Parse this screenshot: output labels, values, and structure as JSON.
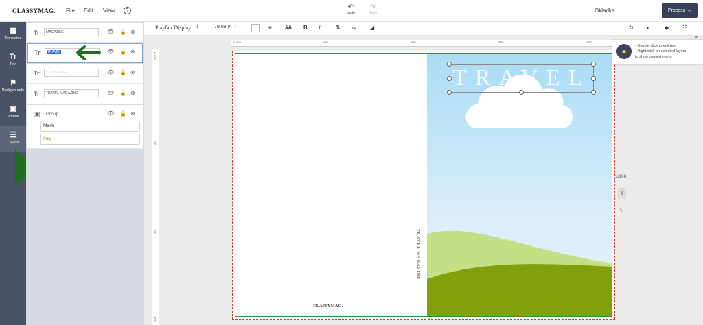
{
  "topbar": {
    "logo": "CLASSYMAG.",
    "menu": [
      "File",
      "Edit",
      "View"
    ],
    "help_glyph": "?",
    "undo_label": "Undo",
    "redo_label": "Redo",
    "doc_title": "Okladka",
    "process_label": "Process →"
  },
  "sidebar": {
    "items": [
      {
        "label": "Templates",
        "icon": "templates-icon"
      },
      {
        "label": "Text",
        "icon": "text-icon"
      },
      {
        "label": "Backgrounds",
        "icon": "backgrounds-icon"
      },
      {
        "label": "Photos",
        "icon": "photos-icon"
      },
      {
        "label": "Layers",
        "icon": "layers-icon"
      }
    ]
  },
  "layers": {
    "items": [
      {
        "type": "Tr",
        "value": "MAGAZINE"
      },
      {
        "type": "Tr",
        "value": "TRAVEL"
      },
      {
        "type": "Tr",
        "value": "CLASSYMAG."
      },
      {
        "type": "Tr",
        "value": "TRAVEL MAGAZINE"
      }
    ],
    "group": {
      "label": "Group",
      "children": [
        "Mask",
        "Img"
      ]
    }
  },
  "toolbar": {
    "font_family": "Playfair Display",
    "font_size": "79.03",
    "unit": "pt",
    "items": [
      "align-icon",
      "letter-spacing-icon",
      "bold-icon",
      "italic-icon",
      "line-height-icon",
      "link-icon",
      "fill-icon"
    ]
  },
  "ruler": {
    "h_labels": [
      "0 mm",
      "100",
      "200",
      "300",
      "400"
    ],
    "v_labels": [
      "0 mm",
      "100",
      "200",
      "300"
    ]
  },
  "canvas": {
    "cover_title": "TRAVEL",
    "spine_text": "TRAVEL MAGAZINE",
    "back_logo": "CLASSYMAG.",
    "colors": {
      "sky_top": "#aadcf5",
      "hill_light": "#c5df84",
      "hill_dark": "#849f0c",
      "cloud": "#ffffff"
    }
  },
  "tip": {
    "lines": [
      "- Double click to edit text",
      "- Right click on selected layers",
      "to show context menu"
    ],
    "close_glyph": "×"
  },
  "page_nav": {
    "counter": "1/106"
  }
}
